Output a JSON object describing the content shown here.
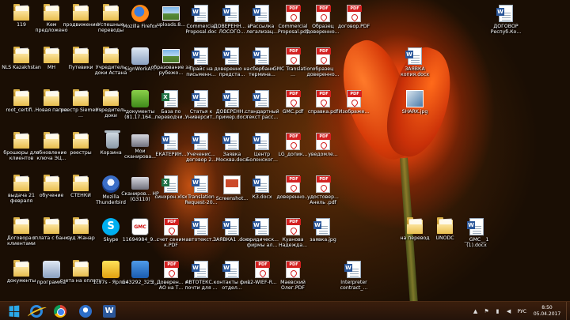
{
  "desktop": {
    "icons": [
      {
        "label": "119",
        "type": "folder"
      },
      {
        "label": "Кем предложено",
        "type": "folder"
      },
      {
        "label": "продвижение",
        "type": "folder"
      },
      {
        "label": "Успешные переводы",
        "type": "folder"
      },
      {
        "label": "Mozilla Firefox",
        "type": "firefox"
      },
      {
        "label": "uploads.8...",
        "type": "image"
      },
      {
        "label": "Commercial Proposal.doc",
        "type": "word"
      },
      {
        "label": "ДОВЕРЕНН... в ЛОСОГО...",
        "type": "word"
      },
      {
        "label": "Рассылка легализац...",
        "type": "word"
      },
      {
        "label": "Commercial Proposal.pdf",
        "type": "pdf"
      },
      {
        "label": "Образец доверенно...",
        "type": "pdf"
      },
      {
        "label": "договор.PDF",
        "type": "pdf"
      },
      {
        "label": "ДОГОВОР Респуб.Ко...",
        "type": "word"
      },
      {
        "label": "NLS Kazakhstan",
        "type": "folder"
      },
      {
        "label": "МН",
        "type": "folder"
      },
      {
        "label": "Путевики",
        "type": "folder"
      },
      {
        "label": "Учредитель доки Астана",
        "type": "folder"
      },
      {
        "label": "SignWorkA...",
        "type": "shortcut"
      },
      {
        "label": "образование за рубежо...",
        "type": "image"
      },
      {
        "label": "Прайс на письменн...",
        "type": "word"
      },
      {
        "label": "доверенно на предста...",
        "type": "word"
      },
      {
        "label": "сбербанк термина...",
        "type": "word"
      },
      {
        "label": "GMC Translation ...",
        "type": "pdf"
      },
      {
        "label": "образец доверенно...",
        "type": "pdf"
      },
      {
        "label": "ЗАЯВКА копия.docx",
        "type": "word"
      },
      {
        "label": "root_certifi...",
        "type": "folder"
      },
      {
        "label": "Новая папка",
        "type": "folder"
      },
      {
        "label": "реестр Siemens ...",
        "type": "folder"
      },
      {
        "label": "Учредитель доки",
        "type": "folder"
      },
      {
        "label": "документы (81.17.164...",
        "type": "green"
      },
      {
        "label": "База по переводчи...",
        "type": "excel"
      },
      {
        "label": "Статья к Университ...",
        "type": "word"
      },
      {
        "label": "ДОВЕРЕНН... пример.docx",
        "type": "word"
      },
      {
        "label": "стандартный текст расс...",
        "type": "word"
      },
      {
        "label": "GMC.pdf",
        "type": "pdf"
      },
      {
        "label": "справка.pdf",
        "type": "pdf"
      },
      {
        "label": "Изображе...",
        "type": "pdf"
      },
      {
        "label": "SHARK.jpg",
        "type": "shark"
      },
      {
        "label": "брошюры для клиентов",
        "type": "folder"
      },
      {
        "label": "обновление ключа ЭЦ...",
        "type": "folder"
      },
      {
        "label": "реестры",
        "type": "folder"
      },
      {
        "label": "Корзина",
        "type": "bin"
      },
      {
        "label": "Мои сканирова...",
        "type": "scanner"
      },
      {
        "label": "ЕКАТЕРИН...",
        "type": "word"
      },
      {
        "label": "Учеченис... договор 2...",
        "type": "word"
      },
      {
        "label": "Заявка Москва.docx",
        "type": "word"
      },
      {
        "label": "Центр Болонског...",
        "type": "word"
      },
      {
        "label": "LG_допик...",
        "type": "pdf"
      },
      {
        "label": "уведомле...",
        "type": "pdf"
      },
      {
        "label": "выдача 21 февраля",
        "type": "folder"
      },
      {
        "label": "обучение",
        "type": "folder"
      },
      {
        "label": "СТЕНКИ",
        "type": "folder"
      },
      {
        "label": "Mozilla Thunderbird",
        "type": "thunderbird"
      },
      {
        "label": "Сканиров... HP (G3110)",
        "type": "scanner"
      },
      {
        "label": "синхрон.xlsx",
        "type": "excel"
      },
      {
        "label": "Translation Request-20...",
        "type": "word"
      },
      {
        "label": "Screenshot...",
        "type": "screenshot"
      },
      {
        "label": "КЗ.docx",
        "type": "word"
      },
      {
        "label": "доверенно...",
        "type": "pdf"
      },
      {
        "label": "удостовер... Анель .pdf",
        "type": "pdf"
      },
      {
        "label": "Договора с клиентами",
        "type": "folder"
      },
      {
        "label": "оплата с банка",
        "type": "folder"
      },
      {
        "label": "суд Жанар",
        "type": "folder"
      },
      {
        "label": "Skype",
        "type": "skype"
      },
      {
        "label": "11694984_9...",
        "type": "gmc"
      },
      {
        "label": "счет сеним к.PDF",
        "type": "pdf"
      },
      {
        "label": "автотекст...",
        "type": "word"
      },
      {
        "label": "ЗАЯВКА1 .docx",
        "type": "word"
      },
      {
        "label": "юридическ... фирмы ал...",
        "type": "word"
      },
      {
        "label": "Куанова Надежда...",
        "type": "pdf"
      },
      {
        "label": "заявка.jpg",
        "type": "word"
      },
      {
        "label": "на перевод",
        "type": "folder"
      },
      {
        "label": "UNODC",
        "type": "folder"
      },
      {
        "label": "__GMC__1 (1).docx",
        "type": "word"
      },
      {
        "label": "документы",
        "type": "folder"
      },
      {
        "label": "программы",
        "type": "shortcut"
      },
      {
        "label": "счета на оплату",
        "type": "folder"
      },
      {
        "label": "1cv7s - Ярлык",
        "type": "yellow"
      },
      {
        "label": "543292_325...",
        "type": "blue"
      },
      {
        "label": "3_Доверен... от АО на Т...",
        "type": "pdf"
      },
      {
        "label": "АВТОТЕКС... почти для ...",
        "type": "word"
      },
      {
        "label": "контакты фин отдел...",
        "type": "word"
      },
      {
        "label": "12-WIEF-R...",
        "type": "pdf"
      },
      {
        "label": "Маевский Олег.PDF",
        "type": "pdf"
      },
      {
        "label": "Interpreter contract_...",
        "type": "word"
      }
    ]
  },
  "taskbar": {
    "apps": [
      "start-button",
      "internet-explorer",
      "google-chrome",
      "thunderbird",
      "word"
    ],
    "language": "РУС",
    "time": "8:50",
    "date": "05.04.2017"
  }
}
